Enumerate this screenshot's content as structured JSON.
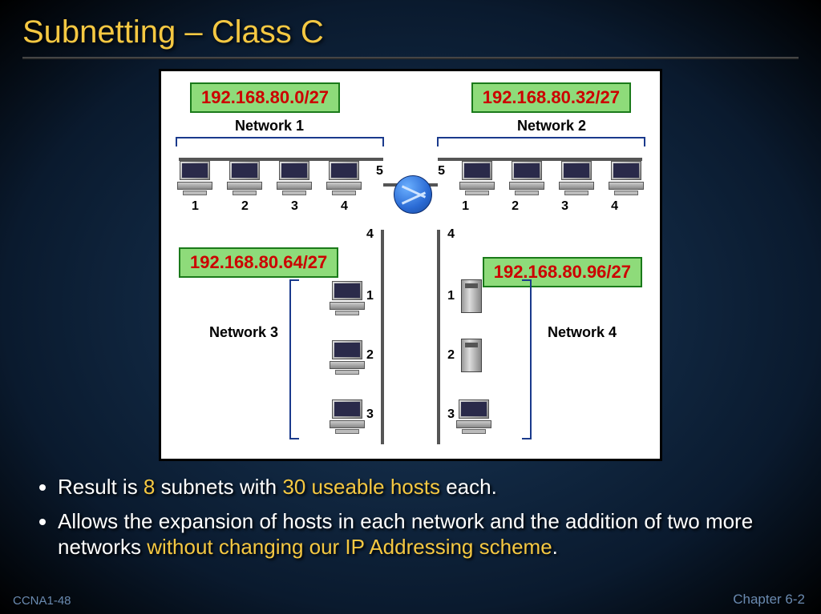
{
  "title": "Subnetting – Class C",
  "subnets": {
    "s1": "192.168.80.0/27",
    "s2": "192.168.80.32/27",
    "s3": "192.168.80.64/27",
    "s4": "192.168.80.96/27"
  },
  "networks": {
    "n1": "Network 1",
    "n2": "Network 2",
    "n3": "Network 3",
    "n4": "Network 4"
  },
  "host_labels": {
    "h1": "1",
    "h2": "2",
    "h3": "3",
    "h4": "4",
    "h5": "5"
  },
  "bullet1": {
    "pre": "Result is ",
    "num_subnets": "8",
    "mid": " subnets with ",
    "hosts": "30 useable hosts",
    "post": " each."
  },
  "bullet2": {
    "pre": "Allows the expansion of hosts in each network and the addition of two more networks ",
    "hl": "without changing our IP Addressing scheme",
    "post": "."
  },
  "footer": {
    "left": "CCNA1-48",
    "right": "Chapter 6-2"
  }
}
